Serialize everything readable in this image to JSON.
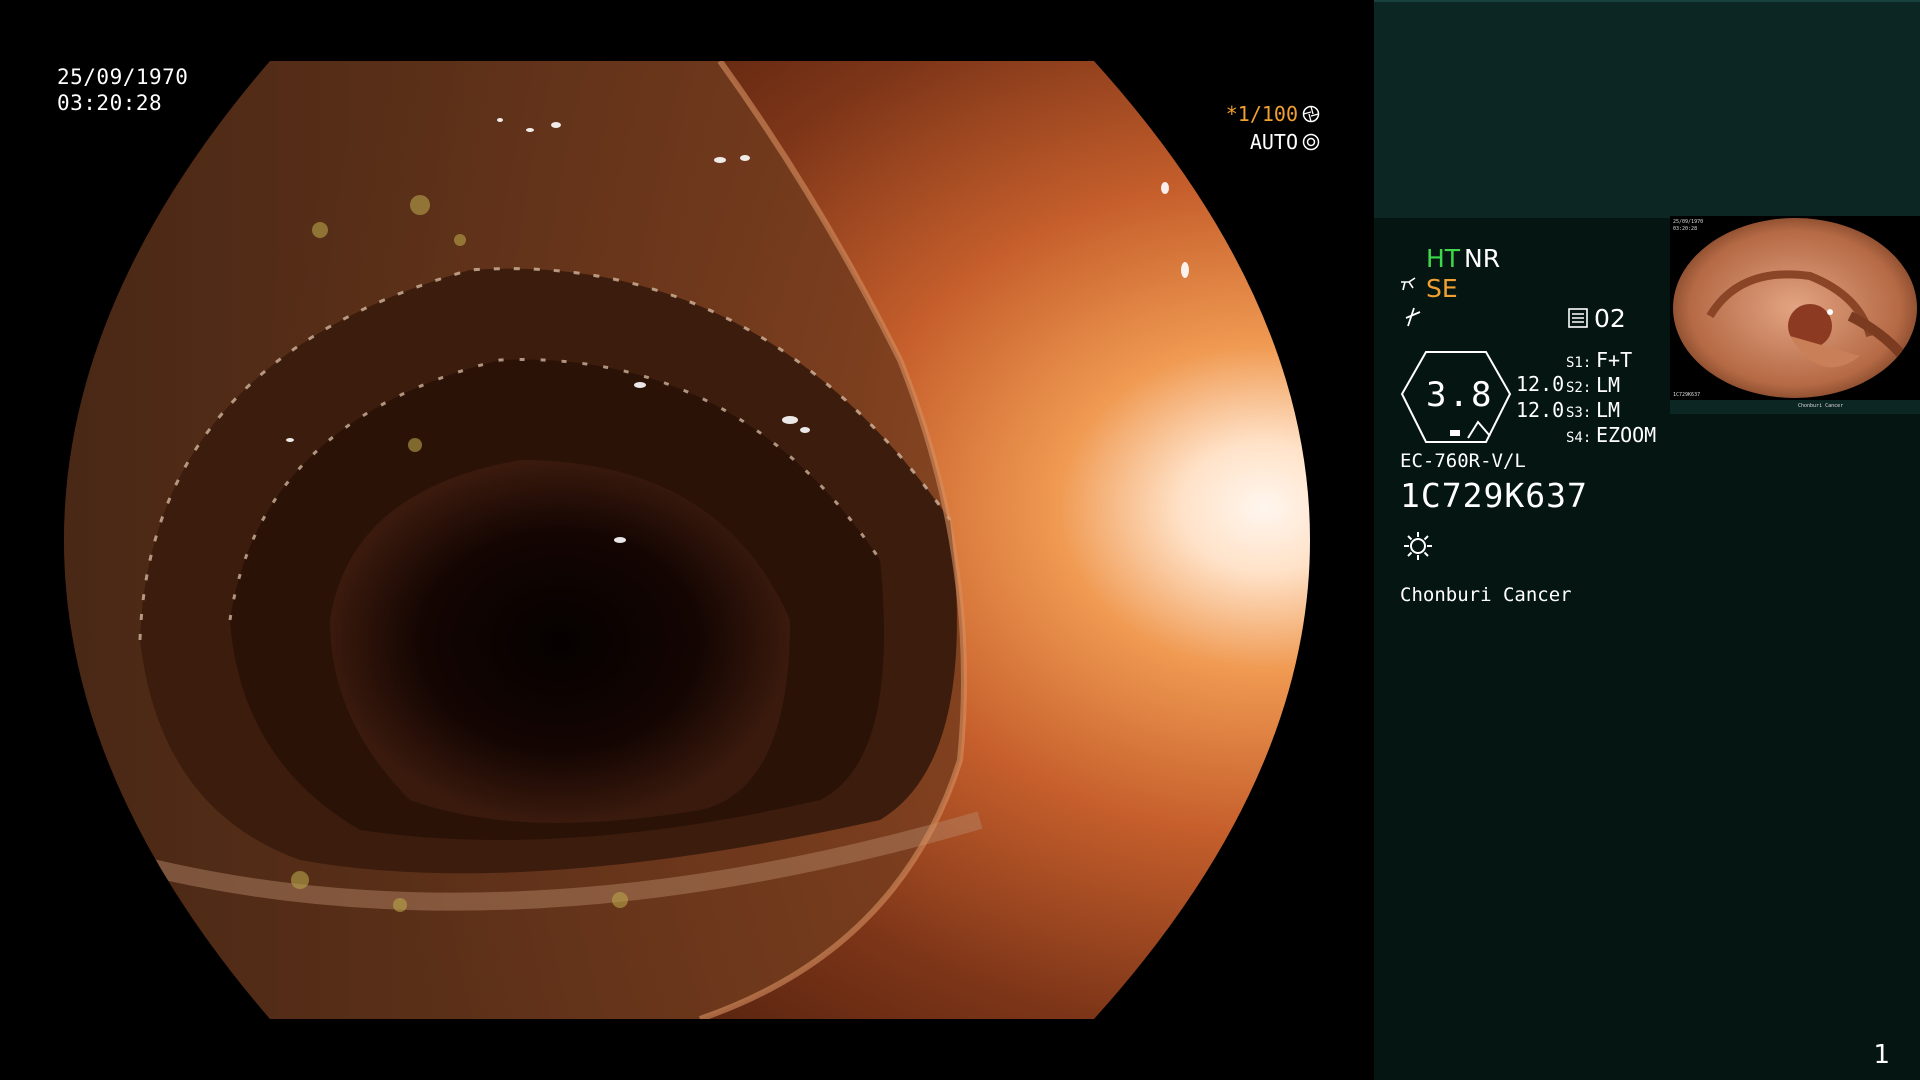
{
  "overlay": {
    "date": "25/09/1970",
    "time": "03:20:28",
    "shutter": "*1/100",
    "iris_mode": "AUTO"
  },
  "panel": {
    "mode_ht": "HT",
    "mode_nr": "NR",
    "mode_se": "SE",
    "memory_number": "02",
    "focus_value": "3.8",
    "focus_param_1": "12.0",
    "focus_param_2": "12.0",
    "switches": [
      {
        "key": "S1:",
        "value": "F+T"
      },
      {
        "key": "S2:",
        "value": "LM"
      },
      {
        "key": "S3:",
        "value": "LM"
      },
      {
        "key": "S4:",
        "value": "EZOOM"
      }
    ],
    "scope_model": "EC-760R-V/L",
    "scope_serial": "1C729K637",
    "institution": "Chonburi Cancer",
    "page_number": "1"
  },
  "thumbnail": {
    "date": "25/09/1970",
    "time": "03:20:28",
    "serial": "1C729K637",
    "institution": "Chonburi Cancer"
  },
  "colors": {
    "accent_green": "#3ed84a",
    "accent_orange": "#f0a030",
    "panel_bg": "#041512",
    "panel_top_bg": "#0c2624"
  },
  "icons": [
    "shutter-icon",
    "iris-icon",
    "structure-enhance-icon",
    "freeze-icon",
    "memory-icon",
    "light-icon"
  ]
}
